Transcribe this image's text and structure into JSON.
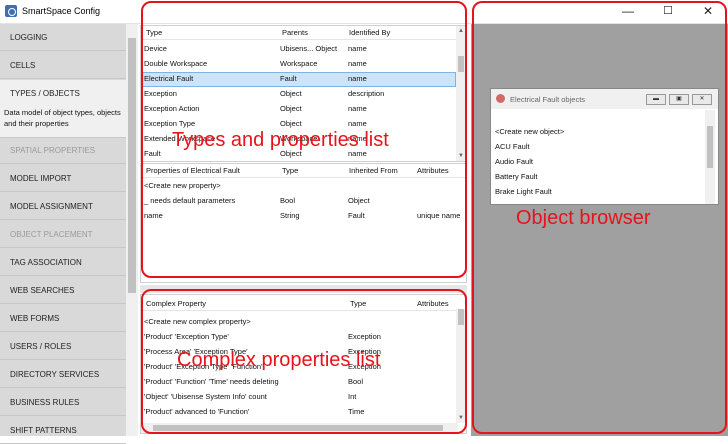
{
  "window": {
    "title": "SmartSpace Config",
    "minimize": "—",
    "maximize": "☐",
    "close": "✕"
  },
  "sidebar": {
    "items": [
      {
        "label": "LOGGING",
        "state": "normal"
      },
      {
        "label": "CELLS",
        "state": "normal"
      },
      {
        "label": "TYPES / OBJECTS",
        "state": "active",
        "desc": "Data model of object types, objects and their properties"
      },
      {
        "label": "SPATIAL PROPERTIES",
        "state": "disabled"
      },
      {
        "label": "MODEL IMPORT",
        "state": "normal"
      },
      {
        "label": "MODEL ASSIGNMENT",
        "state": "normal"
      },
      {
        "label": "OBJECT PLACEMENT",
        "state": "disabled"
      },
      {
        "label": "TAG ASSOCIATION",
        "state": "normal"
      },
      {
        "label": "WEB SEARCHES",
        "state": "normal"
      },
      {
        "label": "WEB FORMS",
        "state": "normal"
      },
      {
        "label": "USERS / ROLES",
        "state": "normal"
      },
      {
        "label": "DIRECTORY SERVICES",
        "state": "normal"
      },
      {
        "label": "BUSINESS RULES",
        "state": "normal"
      },
      {
        "label": "SHIFT PATTERNS",
        "state": "normal"
      }
    ]
  },
  "types_table": {
    "headers": [
      "Type",
      "Parents",
      "Identified By"
    ],
    "rows": [
      [
        "Device",
        "Ubisens... Object",
        "name"
      ],
      [
        "Double Workspace",
        "Workspace",
        "name"
      ],
      [
        "Electrical Fault",
        "Fault",
        "name"
      ],
      [
        "Exception",
        "Object",
        "description"
      ],
      [
        "Exception Action",
        "Object",
        "name"
      ],
      [
        "Exception Type",
        "Object",
        "name"
      ],
      [
        "Extended Workspace",
        "Workspace",
        "name"
      ],
      [
        "Fault",
        "Object",
        "name"
      ]
    ],
    "selected_row": 2
  },
  "properties_table": {
    "headers": [
      "Properties of Electrical Fault",
      "Type",
      "Inherited From",
      "Attributes"
    ],
    "rows": [
      [
        "<Create new property>",
        "",
        "",
        ""
      ],
      [
        "_ needs default parameters",
        "Bool",
        "Object",
        ""
      ],
      [
        "name",
        "String",
        "Fault",
        "unique name"
      ]
    ]
  },
  "complex_table": {
    "headers": [
      "Complex Property",
      "Type",
      "Attributes"
    ],
    "rows": [
      [
        "<Create new complex property>",
        "",
        ""
      ],
      [
        "'Product' 'Exception Type'",
        "Exception",
        ""
      ],
      [
        "'Process Area' 'Exception Type'",
        "Exception",
        ""
      ],
      [
        "'Product' 'Exception Type' 'Function'",
        "Exception",
        ""
      ],
      [
        "'Product' 'Function' 'Time' needs deleting",
        "Bool",
        ""
      ],
      [
        "'Object' 'Ubisense System Info' count",
        "Int",
        ""
      ],
      [
        "'Product' advanced to 'Function'",
        "Time",
        ""
      ]
    ]
  },
  "object_browser": {
    "title": "Electrical Fault objects",
    "items": [
      "<Create new object>",
      "ACU Fault",
      "Audio Fault",
      "Battery Fault",
      "Brake Light Fault"
    ]
  },
  "annotations": {
    "types": "Types and properties list",
    "complex": "Complex properties list",
    "browser": "Object browser"
  },
  "colors": {
    "annotation": "#e8121b",
    "selection": "#cce4f7",
    "sidebar": "#d9d9d9",
    "workspace": "#a0a0a0"
  }
}
